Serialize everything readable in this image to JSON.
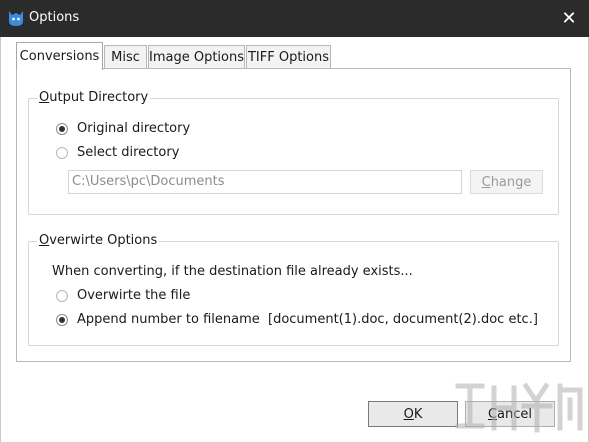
{
  "window": {
    "title": "Options",
    "close_glyph": "✕"
  },
  "tabs": [
    {
      "label": "Conversions",
      "active": true
    },
    {
      "label": "Misc",
      "active": false
    },
    {
      "label": "Image Options",
      "active": false
    },
    {
      "label": "TIFF Options",
      "active": false
    }
  ],
  "output_directory": {
    "legend_underlined": "O",
    "legend_rest": "utput Directory",
    "options": [
      {
        "label": "Original directory",
        "checked": true
      },
      {
        "label": "Select directory",
        "checked": false
      }
    ],
    "path_value": "C:\\Users\\pc\\Documents",
    "change_underlined": "C",
    "change_rest": "hange"
  },
  "overwrite_options": {
    "legend_underlined": "O",
    "legend_rest": "verwirte Options",
    "description": "When converting, if the destination file already exists...",
    "options": [
      {
        "label": "Overwirte the file",
        "checked": false
      },
      {
        "label": "Append number to filename  [document(1).doc, document(2).doc etc.]",
        "checked": true
      }
    ]
  },
  "buttons": {
    "ok_underlined": "O",
    "ok_rest": "K",
    "cancel_underlined": "C",
    "cancel_rest": "ancel"
  },
  "icons": {
    "app": "cat-logo-icon",
    "close": "close-icon",
    "watermark": "watermark-logo"
  },
  "colors": {
    "titlebar": "#2b2b2b",
    "accent": "#1e73c8"
  }
}
